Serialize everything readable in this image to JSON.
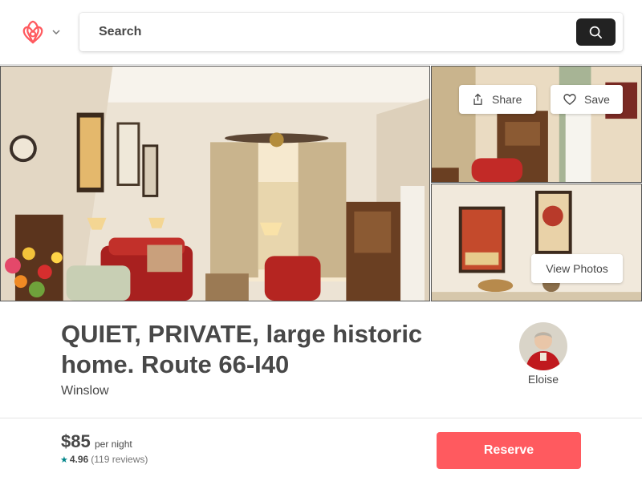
{
  "header": {
    "logo_icon": "airbnb-logo-icon",
    "menu_icon": "chevron-down-icon",
    "search": {
      "placeholder": "Search",
      "button_icon": "search-icon"
    }
  },
  "photos": {
    "share_label": "Share",
    "save_label": "Save",
    "view_photos_label": "View Photos"
  },
  "listing": {
    "title": "QUIET, PRIVATE, large historic home. Route 66-I40",
    "location": "Winslow",
    "host_name": "Eloise"
  },
  "booking": {
    "price": "$85",
    "per_night": "per night",
    "rating": "4.96",
    "reviews": "(119 reviews)",
    "reserve_label": "Reserve"
  },
  "colors": {
    "brand": "#ff5a5f",
    "teal": "#008489",
    "text": "#484848"
  }
}
